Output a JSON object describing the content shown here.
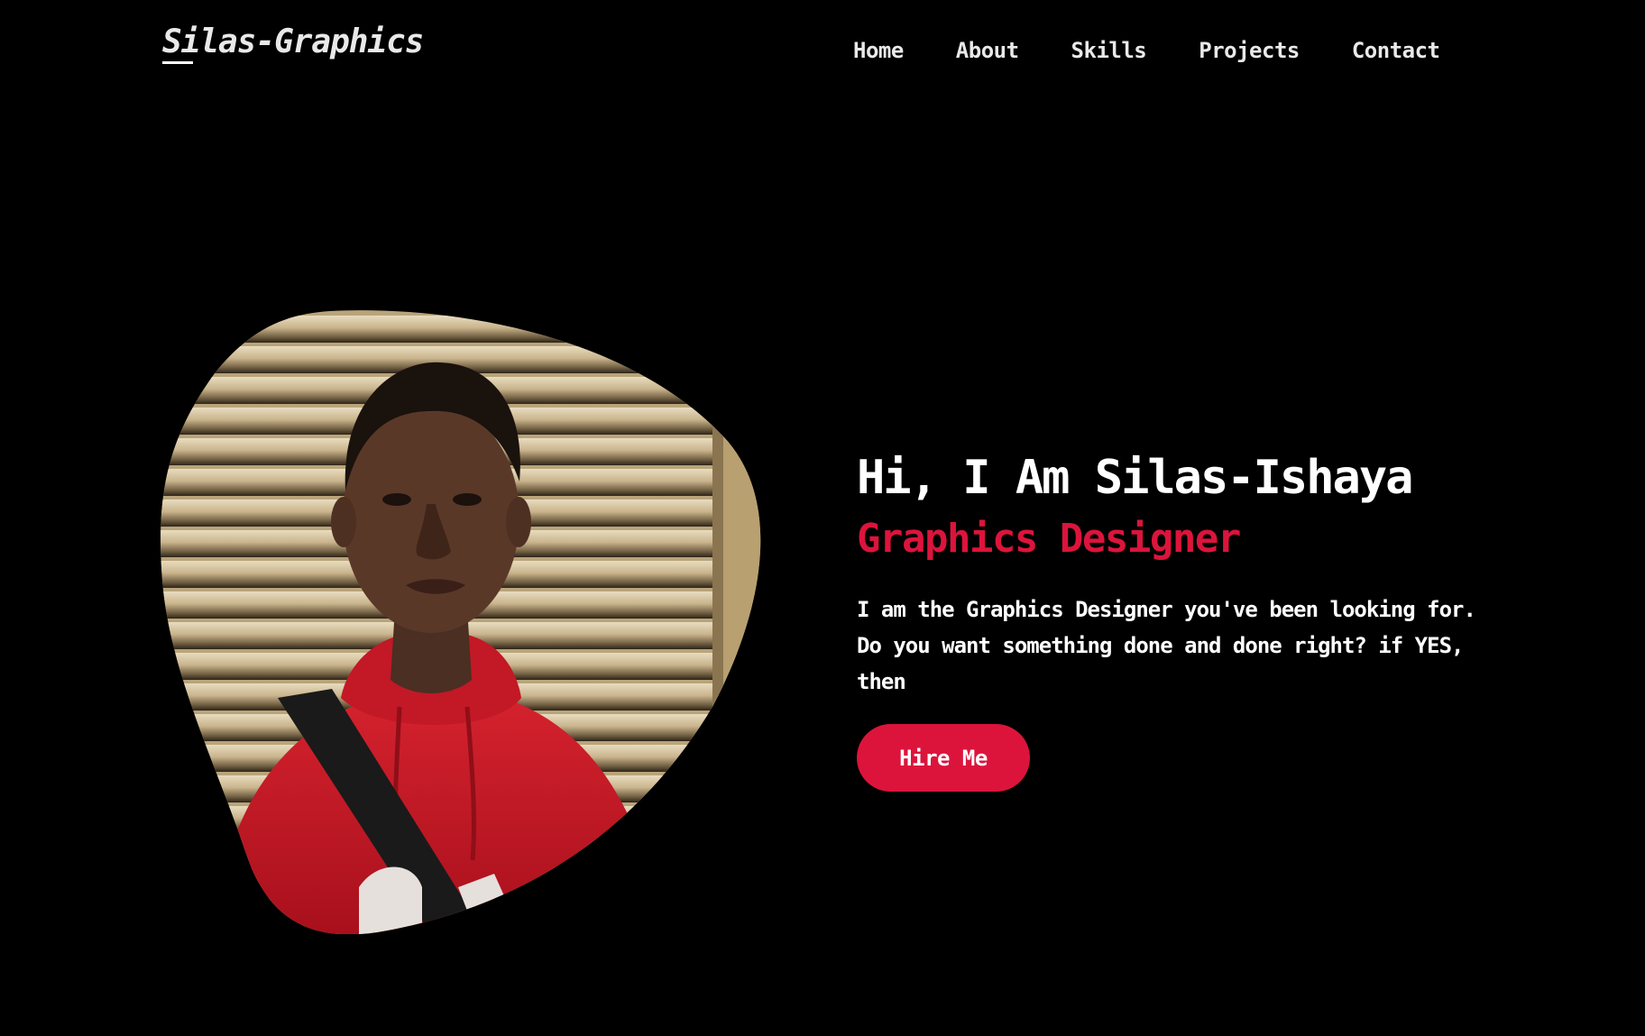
{
  "header": {
    "logo": "Silas-Graphics",
    "nav": [
      {
        "label": "Home"
      },
      {
        "label": "About"
      },
      {
        "label": "Skills"
      },
      {
        "label": "Projects"
      },
      {
        "label": "Contact"
      }
    ]
  },
  "hero": {
    "title": "Hi, I Am Silas-Ishaya",
    "subtitle": "Graphics Designer",
    "text": "I am the Graphics Designer you've been looking for. Do you want something done and done right? if YES, then",
    "button_label": "Hire Me",
    "photo_icon": "portrait-photo"
  },
  "colors": {
    "background": "#000000",
    "text": "#ffffff",
    "accent": "#dc143c",
    "nav_text": "#e9e9e9"
  }
}
